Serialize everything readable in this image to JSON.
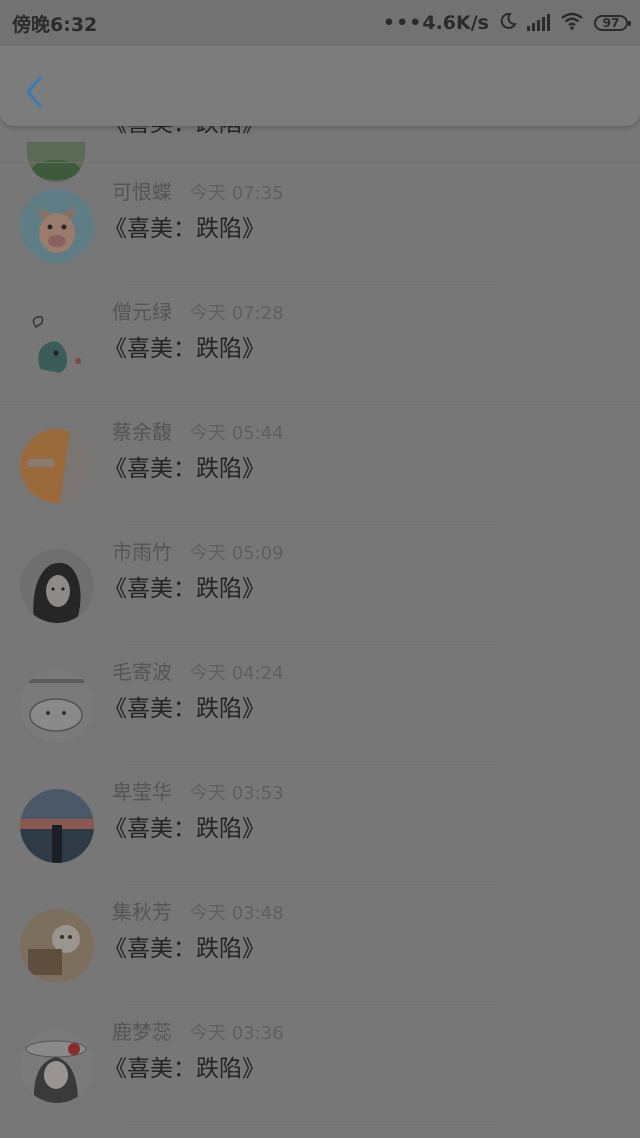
{
  "status_bar": {
    "time": "傍晚6:32",
    "net_speed": "4.6K/s",
    "battery": "97"
  },
  "partial_item": {
    "message": "《喜美：跌陷》"
  },
  "items": [
    {
      "name": "可恨蝶",
      "time": "今天 07:35",
      "message": "《喜美：跌陷》"
    },
    {
      "name": "僧元绿",
      "time": "今天 07:28",
      "message": "《喜美：跌陷》"
    },
    {
      "name": "蔡余馥",
      "time": "今天 05:44",
      "message": "《喜美：跌陷》"
    },
    {
      "name": "市雨竹",
      "time": "今天 05:09",
      "message": "《喜美：跌陷》"
    },
    {
      "name": "毛寄波",
      "time": "今天 04:24",
      "message": "《喜美：跌陷》"
    },
    {
      "name": "卑莹华",
      "time": "今天 03:53",
      "message": "《喜美：跌陷》"
    },
    {
      "name": "集秋芳",
      "time": "今天 03:48",
      "message": "《喜美：跌陷》"
    },
    {
      "name": "鹿梦蕊",
      "time": "今天 03:36",
      "message": "《喜美：跌陷》"
    }
  ],
  "colors": {
    "overlay": "#777777",
    "back_icon": "#3a7bb8"
  }
}
